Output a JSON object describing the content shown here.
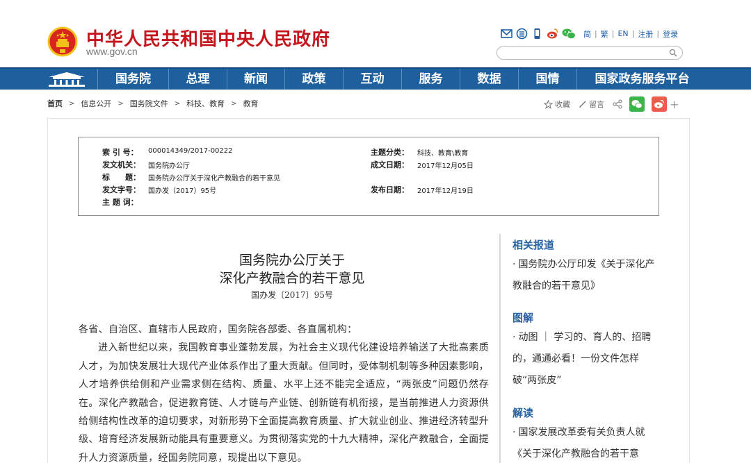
{
  "header": {
    "site_title": "中华人民共和国中央人民政府",
    "site_domain": "www.gov.cn",
    "lang_links": [
      "简",
      "繁",
      "EN",
      "注册",
      "登录"
    ],
    "tool_icons": [
      "mail-icon",
      "rss-icon",
      "mobile-icon",
      "weibo-icon",
      "wechat-icon"
    ]
  },
  "nav": {
    "items": [
      "国务院",
      "总理",
      "新闻",
      "政策",
      "互动",
      "服务",
      "数据",
      "国情",
      "国家政务服务平台"
    ]
  },
  "breadcrumb": [
    "首页",
    "信息公开",
    "国务院文件",
    "科技、教育",
    "教育"
  ],
  "share": {
    "collect": "收藏",
    "comment": "留言"
  },
  "meta": {
    "index_label": "索 引 号：",
    "index_value": "000014349/2017-00222",
    "category_label": "主题分类：",
    "category_value": "科技、教育\\教育",
    "issuer_label": "发文机关：",
    "issuer_value": "国务院办公厅",
    "created_label": "成文日期：",
    "created_value": "2017年12月05日",
    "title_label": "标　　题：",
    "title_value": "国务院办公厅关于深化产教融合的若干意见",
    "docno_label": "发文字号：",
    "docno_value": "国办发（2017）95号",
    "published_label": "发布日期：",
    "published_value": "2017年12月19日",
    "keywords_label": "主 题 词："
  },
  "article": {
    "title_line1": "国务院办公厅关于",
    "title_line2": "深化产教融合的若干意见",
    "doc_number": "国办发〔2017〕95号",
    "salutation": "各省、自治区、直辖市人民政府，国务院各部委、各直属机构：",
    "paragraph": "进入新世纪以来，我国教育事业蓬勃发展，为社会主义现代化建设培养输送了大批高素质人才，为加快发展壮大现代产业体系作出了重大贡献。但同时，受体制机制等多种因素影响，人才培养供给侧和产业需求侧在结构、质量、水平上还不能完全适应，“两张皮”问题仍然存在。深化产教融合，促进教育链、人才链与产业链、创新链有机衔接，是当前推进人力资源供给侧结构性改革的迫切要求，对新形势下全面提高教育质量、扩大就业创业、推进经济转型升级、培育经济发展新动能具有重要意义。为贯彻落实党的十九大精神，深化产教融合，全面提升人力资源质量，经国务院同意，现提出以下意见。"
  },
  "side": {
    "related_heading": "相关报道",
    "related_item": "国务院办公厅印发《关于深化产教融合的若干意见》",
    "graphic_heading": "图解",
    "graphic_item": "动图 ｜ 学习的、育人的、招聘的，通通必看！一份文件怎样破“两张皮”",
    "interpret_heading": "解读",
    "interpret_item": "国家发展改革委有关负责人就《关于深化产教融合的若干意"
  }
}
